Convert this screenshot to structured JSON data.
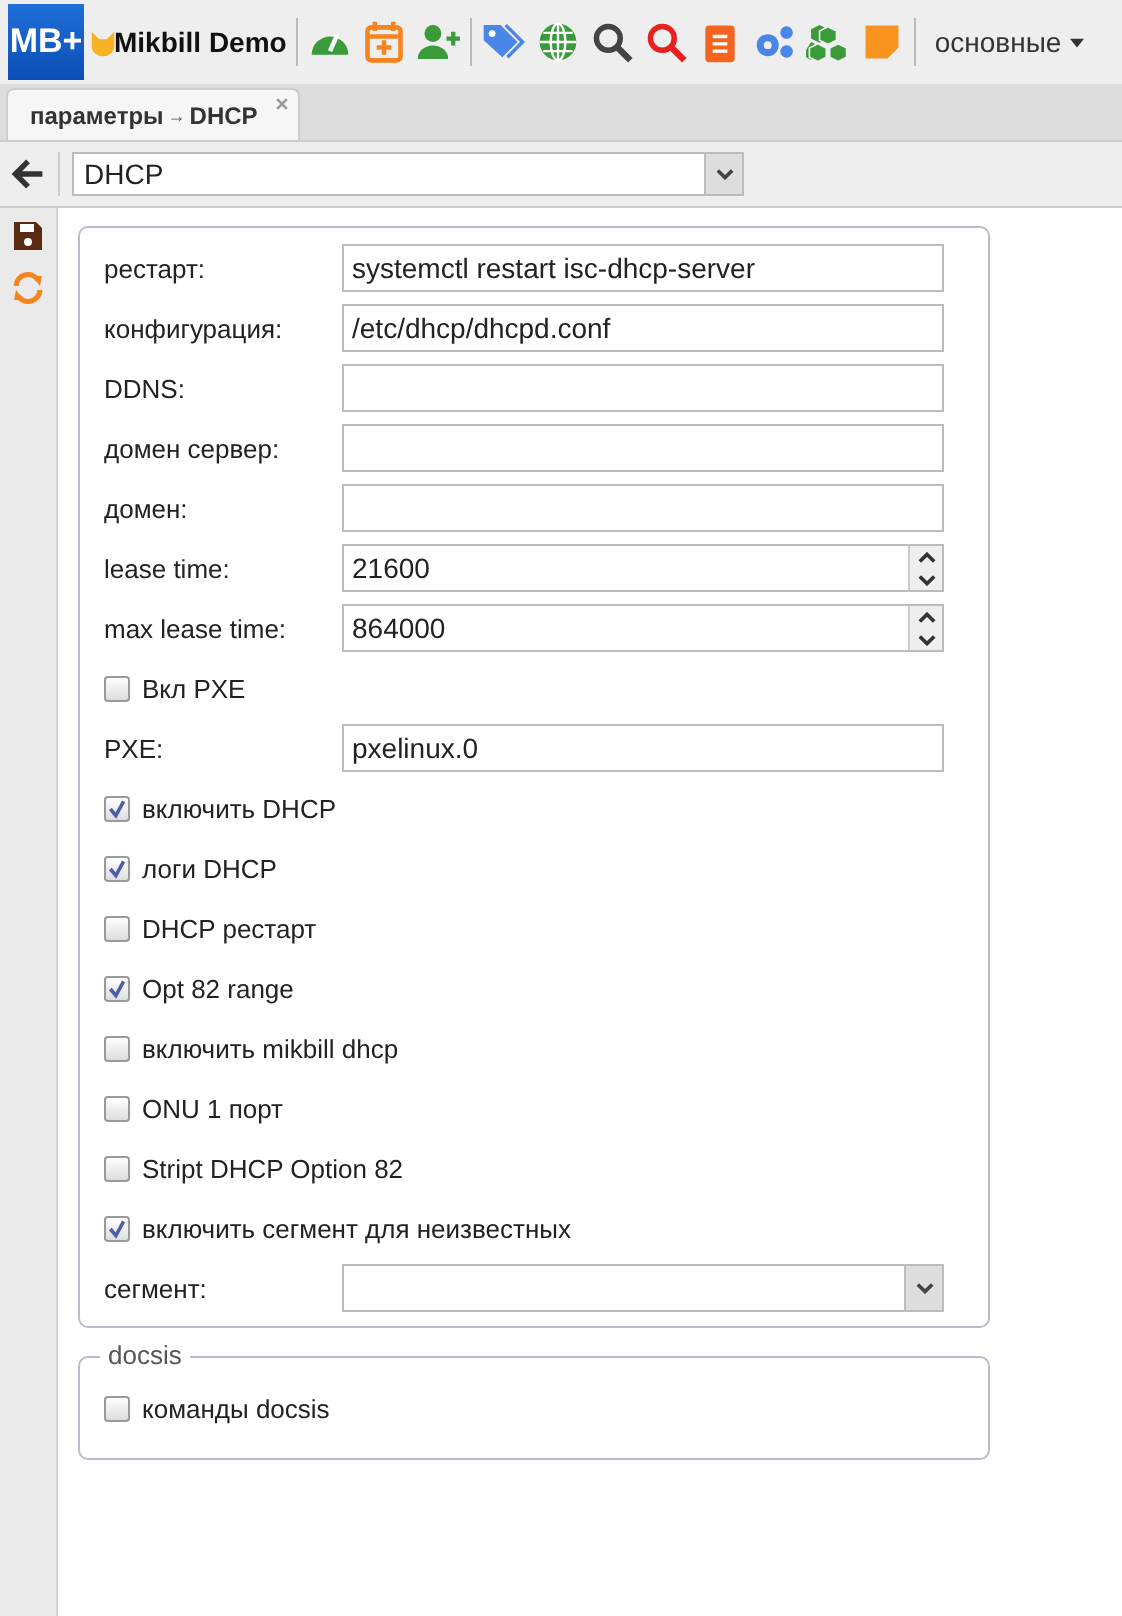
{
  "toolbar": {
    "logo": "MB+",
    "brand": "Mikbill Demo",
    "menu": "основные"
  },
  "tabs": [
    {
      "label": "параметры",
      "arrow": "→",
      "page": "DHCP",
      "selected": true
    }
  ],
  "nav": {
    "select_value": "DHCP"
  },
  "form": [
    {
      "kind": "text",
      "label": "рестарт:",
      "value": "systemctl restart isc-dhcp-server"
    },
    {
      "kind": "text",
      "label": "конфигурация:",
      "value": "/etc/dhcp/dhcpd.conf"
    },
    {
      "kind": "text",
      "label": "DDNS:"
    },
    {
      "kind": "text",
      "label": "домен сервер:"
    },
    {
      "kind": "text",
      "label": "домен:"
    },
    {
      "kind": "spinner",
      "label": "lease time:",
      "value": "21600"
    },
    {
      "kind": "spinner",
      "label": "max lease time:",
      "value": "864000"
    },
    {
      "kind": "checkbox",
      "label": "Вкл PXE",
      "checked": false
    },
    {
      "kind": "text",
      "label": "PXE:",
      "value": "pxelinux.0"
    },
    {
      "kind": "checkbox",
      "label": "включить DHCP",
      "checked": true
    },
    {
      "kind": "checkbox",
      "label": "логи DHCP",
      "checked": true
    },
    {
      "kind": "checkbox",
      "label": "DHCP рестарт",
      "checked": false
    },
    {
      "kind": "checkbox",
      "label": "Opt 82 range",
      "checked": true
    },
    {
      "kind": "checkbox",
      "label": "включить mikbill dhcp",
      "checked": false
    },
    {
      "kind": "checkbox",
      "label": "ONU 1 порт",
      "checked": false
    },
    {
      "kind": "checkbox",
      "label": "Stript DHCP Option 82",
      "checked": false
    },
    {
      "kind": "checkbox",
      "label": "включить сегмент для неизвестных",
      "checked": true
    },
    {
      "kind": "select",
      "label": "сегмент:"
    }
  ],
  "docsis": {
    "legend": "docsis",
    "items": [
      {
        "kind": "checkbox",
        "label": "команды docsis",
        "checked": false
      }
    ]
  }
}
